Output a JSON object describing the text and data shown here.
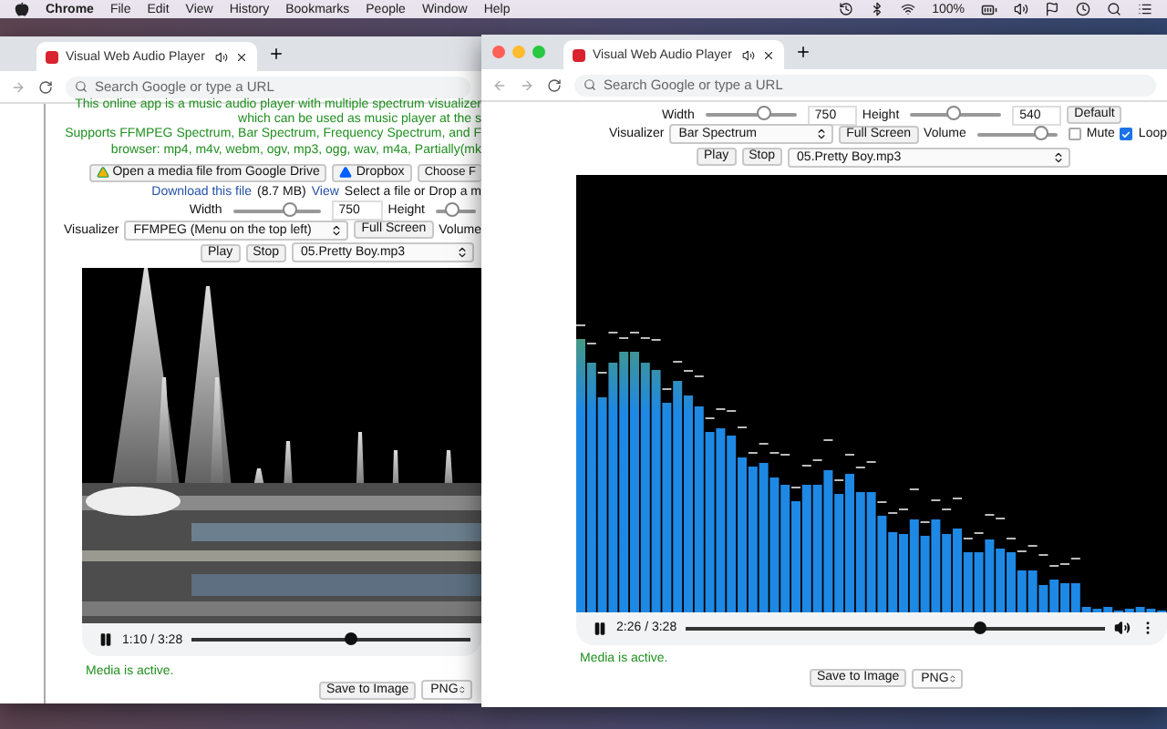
{
  "menu_bar": {
    "app": "Chrome",
    "menus": [
      "File",
      "Edit",
      "View",
      "History",
      "Bookmarks",
      "People",
      "Window",
      "Help"
    ],
    "battery": "100%"
  },
  "back_window": {
    "tab": {
      "title": "Visual Web Audio Player"
    },
    "address": {
      "placeholder": "Search Google or type a URL"
    },
    "intro": [
      "This online app is a music audio player with multiple spectrum visualizer",
      "which can be used as music player at the s",
      "Supports FFMPEG Spectrum, Bar Spectrum, Frequency Spectrum, and F",
      "browser: mp4, m4v, webm, ogv, mp3, ogg, wav, m4a, Partially(mk"
    ],
    "sources": [
      "Open a media file from Google Drive",
      "Dropbox",
      "Choose F"
    ],
    "download": {
      "link": "Download this file",
      "size": "(8.7 MB)",
      "view": "View",
      "hint": "Select a file or Drop a m"
    },
    "sliders": [
      {
        "label": "Width",
        "level": 0.65,
        "value": "750"
      },
      {
        "label": "Height",
        "level": 0.4
      }
    ],
    "visualizer": {
      "label": "Visualizer",
      "value": "FFMPEG (Menu on the top left)"
    },
    "full_screen": "Full Screen",
    "volume": {
      "label": "Volume"
    },
    "play": "Play",
    "stop": "Stop",
    "track": "05.Pretty Boy.mp3",
    "player": {
      "time": "1:10 / 3:28",
      "level": 0.57
    },
    "status": "Media is active.",
    "save": {
      "label": "Save to Image",
      "format": "PNG"
    }
  },
  "front_window": {
    "tab": {
      "title": "Visual Web Audio Player"
    },
    "address": {
      "placeholder": "Search Google or type a URL"
    },
    "sliders": [
      {
        "label": "Width",
        "level": 0.65,
        "value": "750"
      },
      {
        "label": "Height",
        "level": 0.47,
        "value": "540"
      }
    ],
    "default": "Default",
    "visualizer": {
      "label": "Visualizer",
      "value": "Bar Spectrum"
    },
    "full_screen": "Full Screen",
    "volume": {
      "label": "Volume",
      "level": 0.78
    },
    "checks": [
      {
        "label": "Mute",
        "checked": false
      },
      {
        "label": "Loop",
        "checked": true
      }
    ],
    "play": "Play",
    "stop": "Stop",
    "track": "05.Pretty Boy.mp3",
    "player": {
      "time": "2:26 / 3:28",
      "level": 0.7
    },
    "status": "Media is active.",
    "save": {
      "label": "Save to Image",
      "format": "PNG"
    }
  }
}
